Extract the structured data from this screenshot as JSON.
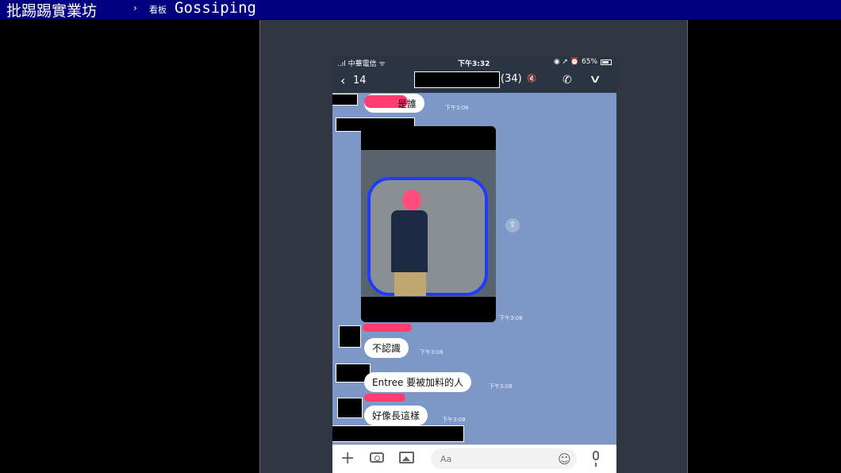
{
  "site": {
    "title": "批踢踢實業坊",
    "arrow": "›",
    "board_label": "看板",
    "board_name": "Gossiping"
  },
  "status_bar": {
    "carrier": "..ıl 中華電信 ᯤ",
    "time": "下午3:32",
    "battery": "◉ ➚ ⏰ 65%"
  },
  "chat_header": {
    "back": "‹",
    "unread": "14",
    "member_count": "(34)",
    "mute": "🔇",
    "call_icon": "phone-icon",
    "chevron": "∨"
  },
  "messages": [
    {
      "text": "是誰",
      "time": "下午3:06"
    },
    {
      "time": "下午3:08"
    },
    {
      "text": "不認識",
      "time": "下午3:08"
    },
    {
      "text": "Entree 要被加料的人",
      "time": "下午3:08"
    },
    {
      "text": "好像長這樣",
      "time": "下午3:08"
    }
  ],
  "input_bar": {
    "placeholder": "Aa",
    "plus": "+",
    "emoji": "☺"
  },
  "colors": {
    "topbar": "#000080",
    "chat_bg": "#7d98c6",
    "redaction_pink": "#ff3d72"
  }
}
